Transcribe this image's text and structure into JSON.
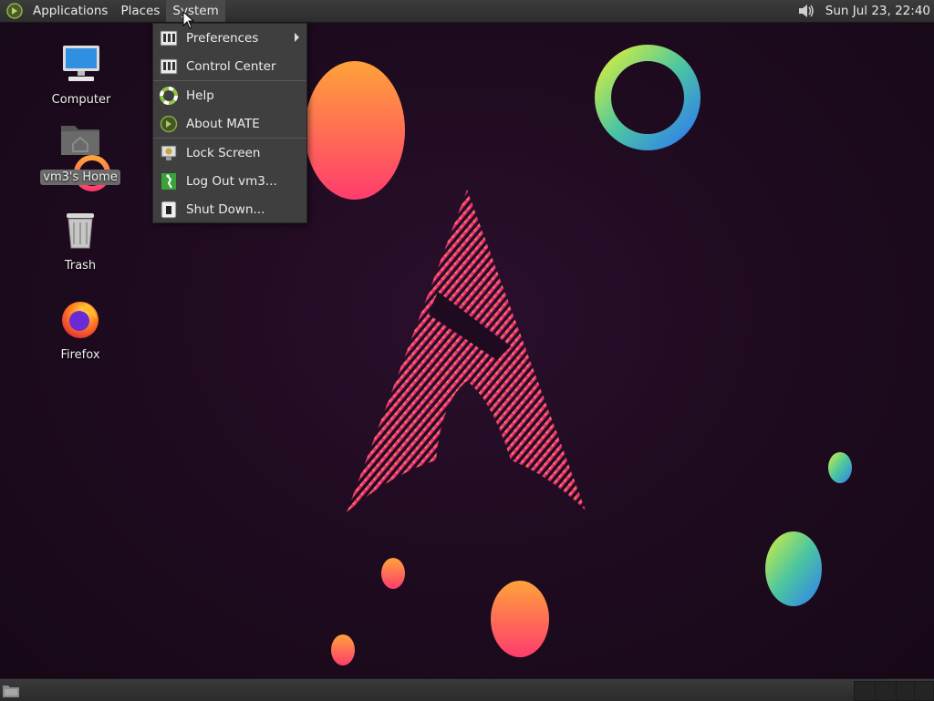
{
  "top_panel": {
    "menus": [
      "Applications",
      "Places",
      "System"
    ],
    "clock": "Sun Jul 23, 22:40",
    "tray_icons": [
      "volume-icon"
    ]
  },
  "desktop": {
    "icons": [
      {
        "label": "Computer",
        "icon": "computer-icon"
      },
      {
        "label": "vm3's Home",
        "icon": "home-folder-icon"
      },
      {
        "label": "Trash",
        "icon": "trash-icon"
      },
      {
        "label": "Firefox",
        "icon": "firefox-icon"
      }
    ]
  },
  "system_menu": {
    "items": [
      {
        "label": "Preferences",
        "icon": "preferences-icon",
        "submenu": true
      },
      {
        "label": "Control Center",
        "icon": "control-center-icon"
      },
      {
        "label": "Help",
        "icon": "help-icon"
      },
      {
        "label": "About MATE",
        "icon": "about-icon"
      },
      {
        "label": "Lock Screen",
        "icon": "lock-screen-icon"
      },
      {
        "label": "Log Out vm3...",
        "icon": "logout-icon"
      },
      {
        "label": "Shut Down...",
        "icon": "shutdown-icon"
      }
    ]
  },
  "colors": {
    "panel": "#2e2e2e",
    "menu_bg": "#3f3f3f",
    "wallpaper": "#1f0b20"
  }
}
